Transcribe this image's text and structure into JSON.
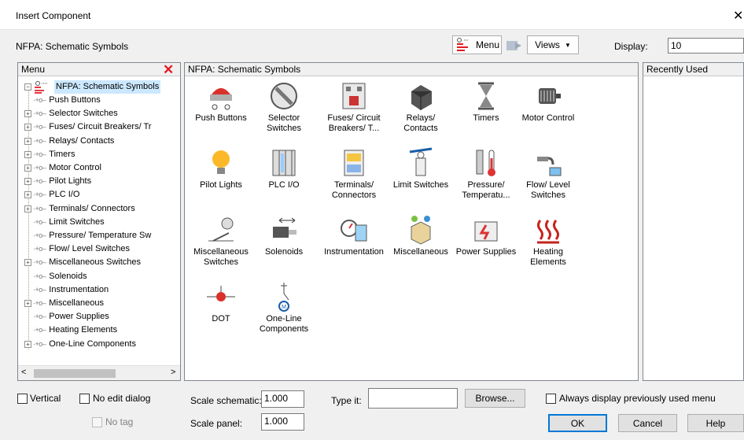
{
  "window": {
    "title": "Insert Component",
    "close_glyph": "✕"
  },
  "header": {
    "library": "NFPA: Schematic Symbols",
    "menu_button": "Menu",
    "views_button": "Views",
    "display_label": "Display:",
    "display_value": "10"
  },
  "menu_panel": {
    "title": "Menu",
    "root": "NFPA: Schematic Symbols",
    "items": [
      {
        "label": "Push Buttons",
        "expandable": false
      },
      {
        "label": "Selector Switches",
        "expandable": true
      },
      {
        "label": "Fuses/ Circuit Breakers/ Tr",
        "expandable": true
      },
      {
        "label": "Relays/ Contacts",
        "expandable": true
      },
      {
        "label": "Timers",
        "expandable": true
      },
      {
        "label": "Motor Control",
        "expandable": true
      },
      {
        "label": "Pilot Lights",
        "expandable": true
      },
      {
        "label": "PLC I/O",
        "expandable": true
      },
      {
        "label": "Terminals/ Connectors",
        "expandable": true
      },
      {
        "label": "Limit Switches",
        "expandable": false
      },
      {
        "label": "Pressure/ Temperature Sw",
        "expandable": false
      },
      {
        "label": "Flow/ Level Switches",
        "expandable": false
      },
      {
        "label": "Miscellaneous Switches",
        "expandable": true
      },
      {
        "label": "Solenoids",
        "expandable": false
      },
      {
        "label": "Instrumentation",
        "expandable": false
      },
      {
        "label": "Miscellaneous",
        "expandable": true
      },
      {
        "label": "Power Supplies",
        "expandable": false
      },
      {
        "label": "Heating Elements",
        "expandable": false
      },
      {
        "label": "One-Line Components",
        "expandable": true
      }
    ]
  },
  "grid_panel": {
    "title": "NFPA: Schematic Symbols",
    "items": [
      {
        "label": "Push Buttons",
        "icon": "push-button-icon"
      },
      {
        "label": "Selector Switches",
        "icon": "selector-switch-icon"
      },
      {
        "label": "Fuses/ Circuit Breakers/ T...",
        "icon": "fuse-breaker-icon"
      },
      {
        "label": "Relays/ Contacts",
        "icon": "relay-icon"
      },
      {
        "label": "Timers",
        "icon": "hourglass-icon"
      },
      {
        "label": "Motor Control",
        "icon": "motor-control-icon"
      },
      {
        "label": "Pilot Lights",
        "icon": "light-bulb-icon"
      },
      {
        "label": "PLC I/O",
        "icon": "plc-icon"
      },
      {
        "label": "Terminals/ Connectors",
        "icon": "terminal-icon"
      },
      {
        "label": "Limit Switches",
        "icon": "limit-switch-icon"
      },
      {
        "label": "Pressure/ Temperatu...",
        "icon": "pressure-temperature-icon"
      },
      {
        "label": "Flow/ Level Switches",
        "icon": "flow-level-icon"
      },
      {
        "label": "Miscellaneous Switches",
        "icon": "misc-switch-icon"
      },
      {
        "label": "Solenoids",
        "icon": "solenoid-icon"
      },
      {
        "label": "Instrumentation",
        "icon": "gauge-icon"
      },
      {
        "label": "Miscellaneous",
        "icon": "misc-box-icon"
      },
      {
        "label": "Power Supplies",
        "icon": "battery-icon"
      },
      {
        "label": "Heating Elements",
        "icon": "heating-icon"
      },
      {
        "label": "DOT",
        "icon": "dot-icon"
      },
      {
        "label": "One-Line Components",
        "icon": "one-line-icon"
      }
    ]
  },
  "recent_panel": {
    "title": "Recently Used"
  },
  "footer": {
    "vertical": "Vertical",
    "no_edit_dialog": "No edit dialog",
    "no_tag": "No tag",
    "scale_schematic_label": "Scale schematic:",
    "scale_schematic_value": "1.000",
    "scale_panel_label": "Scale panel:",
    "scale_panel_value": "1.000",
    "type_it_label": "Type it:",
    "type_it_value": "",
    "browse": "Browse...",
    "always_display": "Always display previously used menu",
    "ok": "OK",
    "cancel": "Cancel",
    "help": "Help"
  },
  "colors": {
    "accent_red": "#e31b23",
    "selected": "#cce8ff",
    "border": "#828790"
  }
}
